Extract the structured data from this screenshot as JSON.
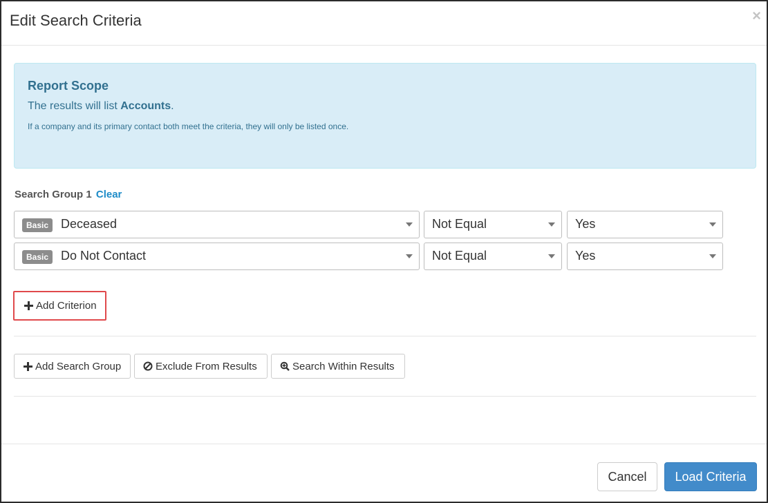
{
  "modal": {
    "title": "Edit Search Criteria",
    "close_glyph": "×"
  },
  "report_scope": {
    "title": "Report Scope",
    "line_prefix": "The results will list ",
    "line_bold": "Accounts",
    "line_suffix": ".",
    "note": "If a company and its primary contact both meet the criteria, they will only be listed once."
  },
  "search_group": {
    "label": "Search Group 1",
    "clear_label": "Clear",
    "criteria": [
      {
        "badge": "Basic",
        "field": "Deceased",
        "operator": "Not Equal",
        "value": "Yes"
      },
      {
        "badge": "Basic",
        "field": "Do Not Contact",
        "operator": "Not Equal",
        "value": "Yes"
      }
    ],
    "add_criterion_label": "Add Criterion"
  },
  "actions": {
    "add_search_group": "Add Search Group",
    "exclude_from_results": "Exclude From Results",
    "search_within_results": "Search Within Results"
  },
  "footer": {
    "cancel": "Cancel",
    "load_criteria": "Load Criteria"
  },
  "colors": {
    "info_bg": "#d9edf7",
    "info_text": "#31708f",
    "link": "#1e8cc8",
    "primary": "#428bca",
    "highlight": "#e0494b",
    "badge": "#8c8c8c"
  },
  "icons": {
    "close": "close-icon",
    "dropdown": "caret-down-icon",
    "add": "plus-icon",
    "exclude": "ban-icon",
    "search_within": "zoom-in-icon"
  }
}
